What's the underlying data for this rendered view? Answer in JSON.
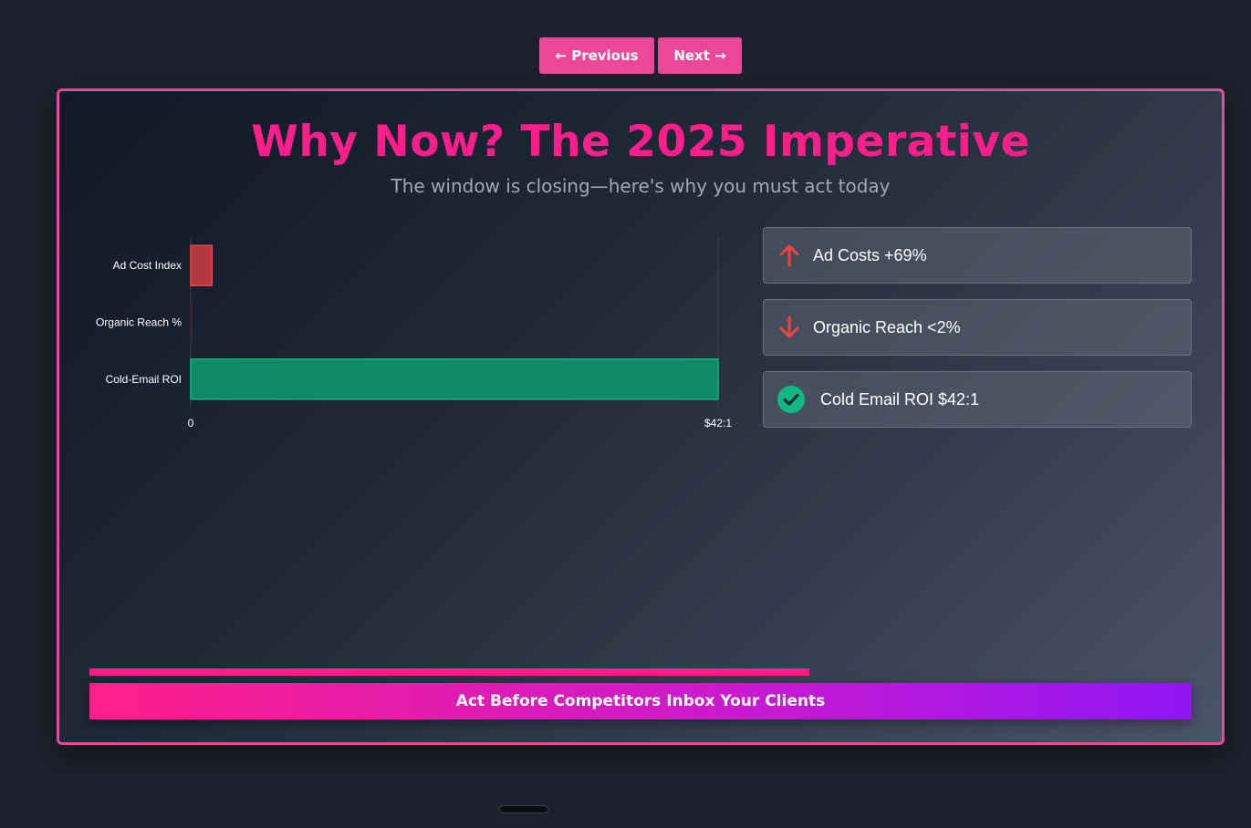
{
  "nav": {
    "prev_label": "← Previous",
    "next_label": "Next →"
  },
  "slide": {
    "title": "Why Now? The 2025 Imperative",
    "subtitle": "The window is closing—here's why you must act today"
  },
  "chart_data": {
    "type": "bar",
    "orientation": "horizontal",
    "categories": [
      "Ad Cost Index",
      "Organic Reach %",
      "Cold-Email ROI"
    ],
    "values": [
      1.69,
      0.02,
      42
    ],
    "colors": [
      "#b3383f",
      "#1d2432",
      "#0e8a66"
    ],
    "xlim": [
      0,
      42
    ],
    "xtick_labels": [
      "0",
      "$42:1"
    ],
    "grid": false,
    "legend": "none"
  },
  "cards": [
    {
      "icon": "arrow-up-icon",
      "text": "Ad Costs +69%",
      "color": "#ef4444"
    },
    {
      "icon": "arrow-down-icon",
      "text": "Organic Reach <2%",
      "color": "#ef4444"
    },
    {
      "icon": "check-circle-icon",
      "text": "Cold Email ROI $42:1",
      "color": "#10b981"
    }
  ],
  "progress": {
    "fraction": 0.653,
    "color": "#ff1f8a"
  },
  "cta": {
    "label": "Act Before Competitors Inbox Your Clients"
  }
}
